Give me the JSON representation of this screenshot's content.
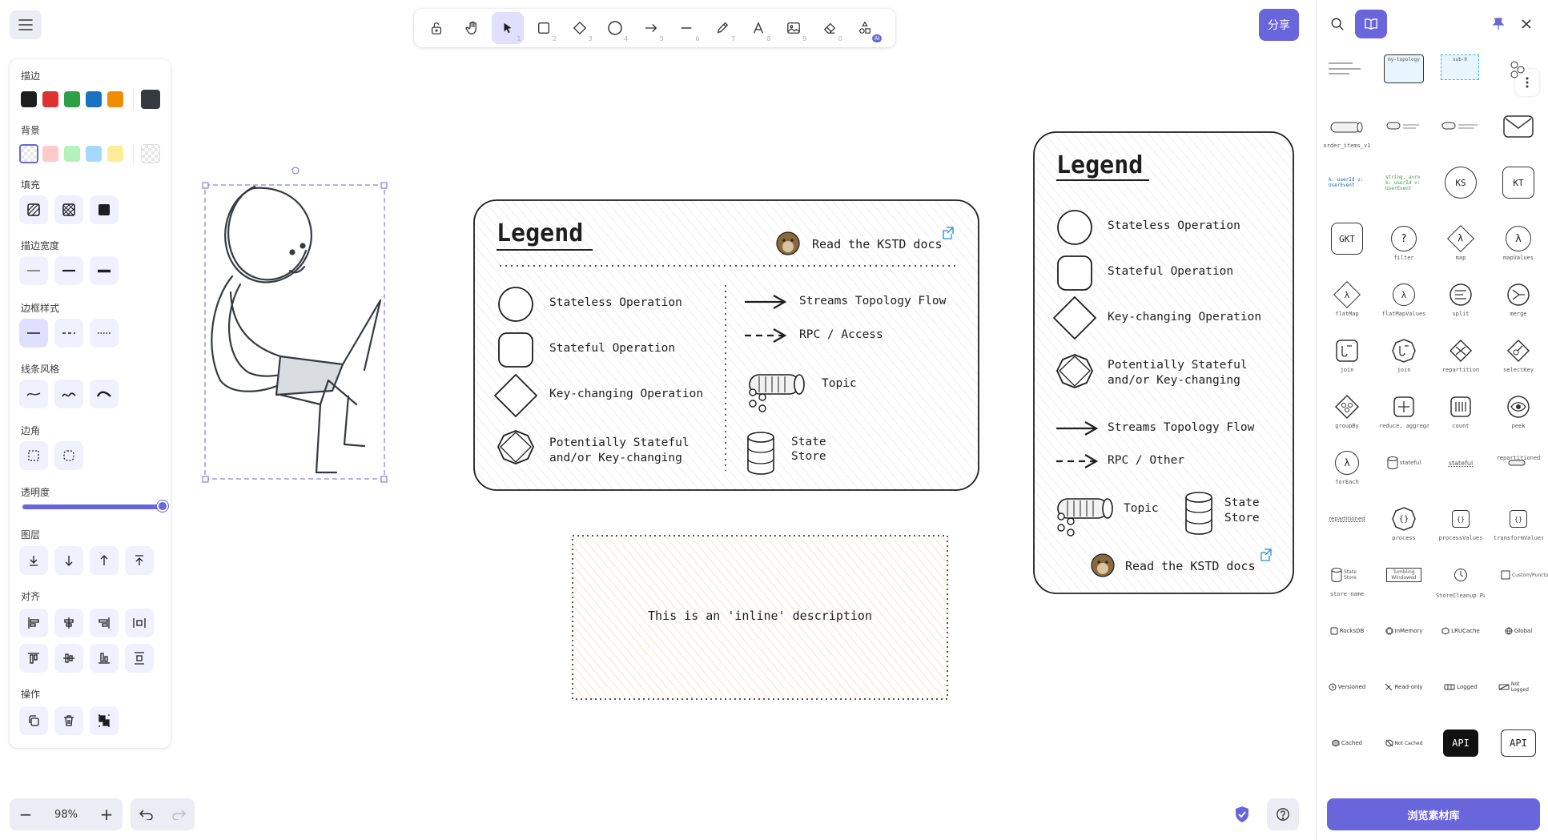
{
  "toolbar": {
    "share_label": "分享",
    "tools": [
      {
        "name": "lock",
        "key": ""
      },
      {
        "name": "hand",
        "key": ""
      },
      {
        "name": "selection",
        "key": "1"
      },
      {
        "name": "rectangle",
        "key": "2"
      },
      {
        "name": "diamond",
        "key": "3"
      },
      {
        "name": "ellipse",
        "key": "4"
      },
      {
        "name": "arrow",
        "key": "5"
      },
      {
        "name": "line",
        "key": "6"
      },
      {
        "name": "draw",
        "key": "7"
      },
      {
        "name": "text",
        "key": "8"
      },
      {
        "name": "image",
        "key": "9"
      },
      {
        "name": "eraser",
        "key": "0"
      },
      {
        "name": "more-tools",
        "key": "AI"
      }
    ]
  },
  "properties": {
    "stroke_label": "描边",
    "background_label": "背景",
    "fill_label": "填充",
    "stroke_width_label": "描边宽度",
    "stroke_style_label": "边框样式",
    "sloppiness_label": "线条风格",
    "edges_label": "边角",
    "opacity_label": "透明度",
    "layers_label": "图层",
    "align_label": "对齐",
    "actions_label": "操作",
    "opacity_value": 1.0,
    "stroke_colors": [
      "#1e1e1e",
      "#e03131",
      "#2f9e44",
      "#1971c2",
      "#f08c00"
    ],
    "stroke_current": "#343a40",
    "background_colors": [
      "transparent",
      "#ffc9c9",
      "#b2f2bb",
      "#a5d8ff",
      "#ffec99"
    ],
    "background_current": "transparent"
  },
  "zoom": {
    "value": "98%"
  },
  "canvas": {
    "legend1": {
      "title": "Legend",
      "docs_link": "Read the KSTD docs",
      "stateless": "Stateless Operation",
      "stateful": "Stateful Operation",
      "key_changing": "Key-changing Operation",
      "potentially_line1": "Potentially Stateful",
      "potentially_line2": "and/or Key-changing",
      "flow": "Streams Topology Flow",
      "rpc": "RPC / Access",
      "topic": "Topic",
      "store_line1": "State",
      "store_line2": "Store"
    },
    "legend2": {
      "title": "Legend",
      "stateless": "Stateless Operation",
      "stateful": "Stateful Operation",
      "key_changing": "Key-changing Operation",
      "potentially_line1": "Potentially Stateful",
      "potentially_line2": "and/or Key-changing",
      "flow": "Streams Topology Flow",
      "rpc": "RPC / Other",
      "topic": "Topic",
      "store_line1": "State",
      "store_line2": "Store",
      "docs_link": "Read the KSTD docs"
    },
    "inline_note": "This is an 'inline' description"
  },
  "library": {
    "browse_label": "浏览素材库",
    "items": [
      {
        "label": "Diagram Title",
        "cap": ""
      },
      {
        "label": "my-topology",
        "cap": ""
      },
      {
        "label": "sub-0",
        "cap": ""
      },
      {
        "label": "order_items_v1",
        "cap": "order_items_v1"
      },
      {
        "label": "",
        "cap": ""
      },
      {
        "label": "",
        "cap": ""
      },
      {
        "label": "k: userId v: UserEvent",
        "cap": ""
      },
      {
        "label": "string, avro k: userId v: UserEvent",
        "cap": ""
      },
      {
        "label": "KS",
        "cap": ""
      },
      {
        "label": "KT",
        "cap": ""
      },
      {
        "label": "GKT",
        "cap": ""
      },
      {
        "label": "?",
        "cap": "filter"
      },
      {
        "label": "λ",
        "cap": "map"
      },
      {
        "label": "λ",
        "cap": "mapValues"
      },
      {
        "label": "λ",
        "cap": "flatMap"
      },
      {
        "label": "λ",
        "cap": "flatMapValues"
      },
      {
        "label": "",
        "cap": "split"
      },
      {
        "label": "",
        "cap": "merge"
      },
      {
        "label": "",
        "cap": "join"
      },
      {
        "label": "",
        "cap": "join"
      },
      {
        "label": "",
        "cap": "repartition"
      },
      {
        "label": "",
        "cap": "selectKey"
      },
      {
        "label": "",
        "cap": "groupBy"
      },
      {
        "label": "",
        "cap": "reduce, aggregate"
      },
      {
        "label": "",
        "cap": "count"
      },
      {
        "label": "",
        "cap": "peek"
      },
      {
        "label": "λ",
        "cap": "forEach"
      },
      {
        "label": "",
        "cap": "stateful"
      },
      {
        "label": "",
        "cap": "stateful"
      },
      {
        "label": "",
        "cap": "repartitioned"
      },
      {
        "label": "",
        "cap": "repartitioned"
      },
      {
        "label": "{}",
        "cap": "process"
      },
      {
        "label": "{}",
        "cap": "processValues"
      },
      {
        "label": "{}",
        "cap": "transformValues"
      },
      {
        "label": "State Store",
        "cap": "store-name"
      },
      {
        "label": "Tumbling Windowed",
        "cap": ""
      },
      {
        "label": "",
        "cap": "StoreCleanup Punctuator"
      },
      {
        "label": "",
        "cap": "Custom/Punctuator"
      },
      {
        "label": "RocksDB",
        "cap": ""
      },
      {
        "label": "InMemory",
        "cap": ""
      },
      {
        "label": "LRUCache",
        "cap": ""
      },
      {
        "label": "Global",
        "cap": ""
      },
      {
        "label": "Versioned",
        "cap": ""
      },
      {
        "label": "Read-only",
        "cap": ""
      },
      {
        "label": "Logged",
        "cap": ""
      },
      {
        "label": "Not Logged",
        "cap": ""
      },
      {
        "label": "Cached",
        "cap": ""
      },
      {
        "label": "Not Cached",
        "cap": ""
      },
      {
        "label": "API",
        "cap": ""
      },
      {
        "label": "API",
        "cap": ""
      }
    ]
  }
}
